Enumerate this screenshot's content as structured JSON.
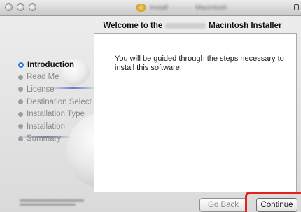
{
  "window": {
    "title": "Install ·········· Macintosh",
    "icon": "package-icon",
    "lock_icon": "lock-icon"
  },
  "heading": {
    "prefix": "Welcome to the",
    "suffix": "Macintosh Installer"
  },
  "sidebar": {
    "steps": [
      {
        "label": "Introduction",
        "active": true
      },
      {
        "label": "Read Me",
        "active": false
      },
      {
        "label": "License",
        "active": false
      },
      {
        "label": "Destination Select",
        "active": false
      },
      {
        "label": "Installation Type",
        "active": false
      },
      {
        "label": "Installation",
        "active": false
      },
      {
        "label": "Summary",
        "active": false
      }
    ]
  },
  "content": {
    "message": "You will be guided through the steps necessary to install this software."
  },
  "buttons": {
    "back": "Go Back",
    "continue": "Continue"
  },
  "colors": {
    "active_step": "#2e7cdc",
    "highlight": "#e3221b"
  }
}
